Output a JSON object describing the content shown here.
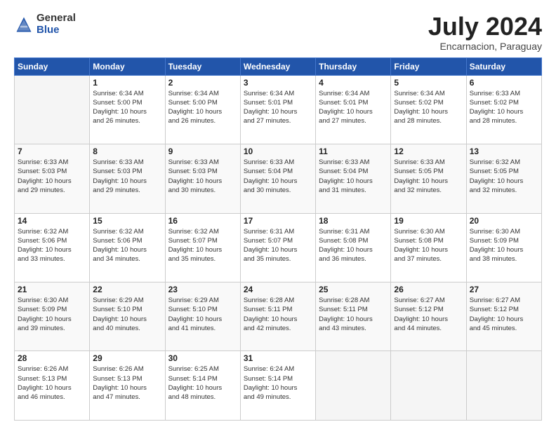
{
  "logo": {
    "general": "General",
    "blue": "Blue"
  },
  "title": "July 2024",
  "subtitle": "Encarnacion, Paraguay",
  "days_header": [
    "Sunday",
    "Monday",
    "Tuesday",
    "Wednesday",
    "Thursday",
    "Friday",
    "Saturday"
  ],
  "weeks": [
    [
      {
        "day": "",
        "sunrise": "",
        "sunset": "",
        "daylight": ""
      },
      {
        "day": "1",
        "sunrise": "Sunrise: 6:34 AM",
        "sunset": "Sunset: 5:00 PM",
        "daylight": "Daylight: 10 hours and 26 minutes."
      },
      {
        "day": "2",
        "sunrise": "Sunrise: 6:34 AM",
        "sunset": "Sunset: 5:00 PM",
        "daylight": "Daylight: 10 hours and 26 minutes."
      },
      {
        "day": "3",
        "sunrise": "Sunrise: 6:34 AM",
        "sunset": "Sunset: 5:01 PM",
        "daylight": "Daylight: 10 hours and 27 minutes."
      },
      {
        "day": "4",
        "sunrise": "Sunrise: 6:34 AM",
        "sunset": "Sunset: 5:01 PM",
        "daylight": "Daylight: 10 hours and 27 minutes."
      },
      {
        "day": "5",
        "sunrise": "Sunrise: 6:34 AM",
        "sunset": "Sunset: 5:02 PM",
        "daylight": "Daylight: 10 hours and 28 minutes."
      },
      {
        "day": "6",
        "sunrise": "Sunrise: 6:33 AM",
        "sunset": "Sunset: 5:02 PM",
        "daylight": "Daylight: 10 hours and 28 minutes."
      }
    ],
    [
      {
        "day": "7",
        "sunrise": "Sunrise: 6:33 AM",
        "sunset": "Sunset: 5:03 PM",
        "daylight": "Daylight: 10 hours and 29 minutes."
      },
      {
        "day": "8",
        "sunrise": "Sunrise: 6:33 AM",
        "sunset": "Sunset: 5:03 PM",
        "daylight": "Daylight: 10 hours and 29 minutes."
      },
      {
        "day": "9",
        "sunrise": "Sunrise: 6:33 AM",
        "sunset": "Sunset: 5:03 PM",
        "daylight": "Daylight: 10 hours and 30 minutes."
      },
      {
        "day": "10",
        "sunrise": "Sunrise: 6:33 AM",
        "sunset": "Sunset: 5:04 PM",
        "daylight": "Daylight: 10 hours and 30 minutes."
      },
      {
        "day": "11",
        "sunrise": "Sunrise: 6:33 AM",
        "sunset": "Sunset: 5:04 PM",
        "daylight": "Daylight: 10 hours and 31 minutes."
      },
      {
        "day": "12",
        "sunrise": "Sunrise: 6:33 AM",
        "sunset": "Sunset: 5:05 PM",
        "daylight": "Daylight: 10 hours and 32 minutes."
      },
      {
        "day": "13",
        "sunrise": "Sunrise: 6:32 AM",
        "sunset": "Sunset: 5:05 PM",
        "daylight": "Daylight: 10 hours and 32 minutes."
      }
    ],
    [
      {
        "day": "14",
        "sunrise": "Sunrise: 6:32 AM",
        "sunset": "Sunset: 5:06 PM",
        "daylight": "Daylight: 10 hours and 33 minutes."
      },
      {
        "day": "15",
        "sunrise": "Sunrise: 6:32 AM",
        "sunset": "Sunset: 5:06 PM",
        "daylight": "Daylight: 10 hours and 34 minutes."
      },
      {
        "day": "16",
        "sunrise": "Sunrise: 6:32 AM",
        "sunset": "Sunset: 5:07 PM",
        "daylight": "Daylight: 10 hours and 35 minutes."
      },
      {
        "day": "17",
        "sunrise": "Sunrise: 6:31 AM",
        "sunset": "Sunset: 5:07 PM",
        "daylight": "Daylight: 10 hours and 35 minutes."
      },
      {
        "day": "18",
        "sunrise": "Sunrise: 6:31 AM",
        "sunset": "Sunset: 5:08 PM",
        "daylight": "Daylight: 10 hours and 36 minutes."
      },
      {
        "day": "19",
        "sunrise": "Sunrise: 6:30 AM",
        "sunset": "Sunset: 5:08 PM",
        "daylight": "Daylight: 10 hours and 37 minutes."
      },
      {
        "day": "20",
        "sunrise": "Sunrise: 6:30 AM",
        "sunset": "Sunset: 5:09 PM",
        "daylight": "Daylight: 10 hours and 38 minutes."
      }
    ],
    [
      {
        "day": "21",
        "sunrise": "Sunrise: 6:30 AM",
        "sunset": "Sunset: 5:09 PM",
        "daylight": "Daylight: 10 hours and 39 minutes."
      },
      {
        "day": "22",
        "sunrise": "Sunrise: 6:29 AM",
        "sunset": "Sunset: 5:10 PM",
        "daylight": "Daylight: 10 hours and 40 minutes."
      },
      {
        "day": "23",
        "sunrise": "Sunrise: 6:29 AM",
        "sunset": "Sunset: 5:10 PM",
        "daylight": "Daylight: 10 hours and 41 minutes."
      },
      {
        "day": "24",
        "sunrise": "Sunrise: 6:28 AM",
        "sunset": "Sunset: 5:11 PM",
        "daylight": "Daylight: 10 hours and 42 minutes."
      },
      {
        "day": "25",
        "sunrise": "Sunrise: 6:28 AM",
        "sunset": "Sunset: 5:11 PM",
        "daylight": "Daylight: 10 hours and 43 minutes."
      },
      {
        "day": "26",
        "sunrise": "Sunrise: 6:27 AM",
        "sunset": "Sunset: 5:12 PM",
        "daylight": "Daylight: 10 hours and 44 minutes."
      },
      {
        "day": "27",
        "sunrise": "Sunrise: 6:27 AM",
        "sunset": "Sunset: 5:12 PM",
        "daylight": "Daylight: 10 hours and 45 minutes."
      }
    ],
    [
      {
        "day": "28",
        "sunrise": "Sunrise: 6:26 AM",
        "sunset": "Sunset: 5:13 PM",
        "daylight": "Daylight: 10 hours and 46 minutes."
      },
      {
        "day": "29",
        "sunrise": "Sunrise: 6:26 AM",
        "sunset": "Sunset: 5:13 PM",
        "daylight": "Daylight: 10 hours and 47 minutes."
      },
      {
        "day": "30",
        "sunrise": "Sunrise: 6:25 AM",
        "sunset": "Sunset: 5:14 PM",
        "daylight": "Daylight: 10 hours and 48 minutes."
      },
      {
        "day": "31",
        "sunrise": "Sunrise: 6:24 AM",
        "sunset": "Sunset: 5:14 PM",
        "daylight": "Daylight: 10 hours and 49 minutes."
      },
      {
        "day": "",
        "sunrise": "",
        "sunset": "",
        "daylight": ""
      },
      {
        "day": "",
        "sunrise": "",
        "sunset": "",
        "daylight": ""
      },
      {
        "day": "",
        "sunrise": "",
        "sunset": "",
        "daylight": ""
      }
    ]
  ]
}
